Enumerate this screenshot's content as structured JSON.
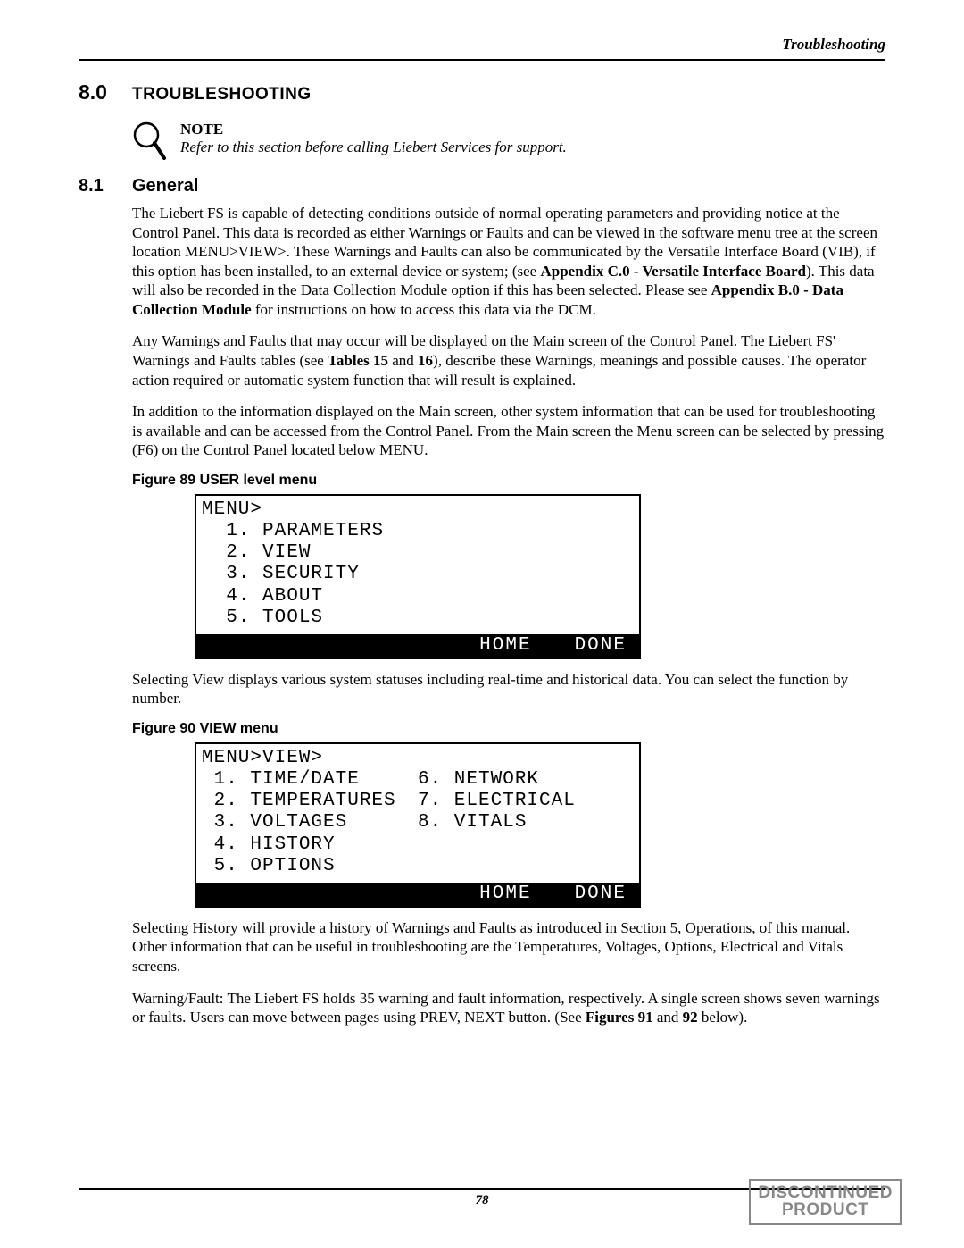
{
  "header": {
    "section_label": "Troubleshooting"
  },
  "sec8": {
    "num": "8.0",
    "title": "TROUBLESHOOTING"
  },
  "note": {
    "head": "NOTE",
    "body": "Refer to this section before calling Liebert Services for support."
  },
  "sec81": {
    "num": "8.1",
    "title": "General"
  },
  "para1": {
    "t1": "The Liebert FS is capable of detecting conditions outside of normal operating parameters and providing notice at the Control Panel. This data is recorded as either Warnings or Faults and can be viewed in the software menu tree at the screen location MENU>VIEW>. These Warnings and Faults can also be communicated by the Versatile Interface Board (VIB), if this option has been installed, to an external device or system; (see ",
    "b1": "Appendix C.0 - Versatile Interface Board",
    "t2": "). This data will also be recorded in the Data Collection Module option if this has been selected. Please see ",
    "b2": "Appendix B.0 - Data Collection Module",
    "t3": " for instructions on how to access this data via the DCM."
  },
  "para2": {
    "t1": "Any Warnings and Faults that may occur will be displayed on the Main screen of the Control Panel. The Liebert FS' Warnings and Faults tables (see ",
    "b1": "Tables 15",
    "t2": " and ",
    "b2": "16",
    "t3": "), describe these Warnings, meanings and possible causes. The operator action required or automatic system function that will result is explained."
  },
  "para3": "In addition to the information displayed on the Main screen, other system information that can be used for troubleshooting is available and can be accessed from the Control Panel. From the Main screen the Menu screen can be selected by pressing (F6) on the Control Panel located below MENU.",
  "fig89": {
    "caption": "Figure 89   USER level menu",
    "lcd": {
      "breadcrumb": "MENU>",
      "items": [
        "1. PARAMETERS",
        "2. VIEW",
        "3. SECURITY",
        "4. ABOUT",
        "5. TOOLS"
      ],
      "btn_home": "HOME",
      "btn_done": "DONE"
    }
  },
  "para4": "Selecting View displays various system statuses including real-time and historical data. You can select the function by number.",
  "fig90": {
    "caption": "Figure 90   VIEW menu",
    "lcd": {
      "breadcrumb": "MENU>VIEW>",
      "left": [
        "1. TIME/DATE",
        "2. TEMPERATURES",
        "3. VOLTAGES",
        "4. HISTORY",
        "5. OPTIONS"
      ],
      "right": [
        "6. NETWORK",
        "7. ELECTRICAL",
        "8. VITALS"
      ],
      "btn_home": "HOME",
      "btn_done": "DONE"
    }
  },
  "para5": "Selecting History will provide a history of Warnings and Faults as introduced in Section 5, Operations, of this manual. Other information that can be useful in troubleshooting are the Temperatures, Voltages, Options, Electrical and Vitals screens.",
  "para6": {
    "t1": "Warning/Fault: The Liebert FS holds 35 warning and fault information, respectively. A single screen shows seven warnings or faults. Users can move between pages using PREV, NEXT button. (See ",
    "b1": "Figures 91",
    "t2": " and ",
    "b2": "92",
    "t3": " below)."
  },
  "footer": {
    "page": "78"
  },
  "stamp": {
    "l1": "DISCONTINUED",
    "l2": "PRODUCT"
  }
}
